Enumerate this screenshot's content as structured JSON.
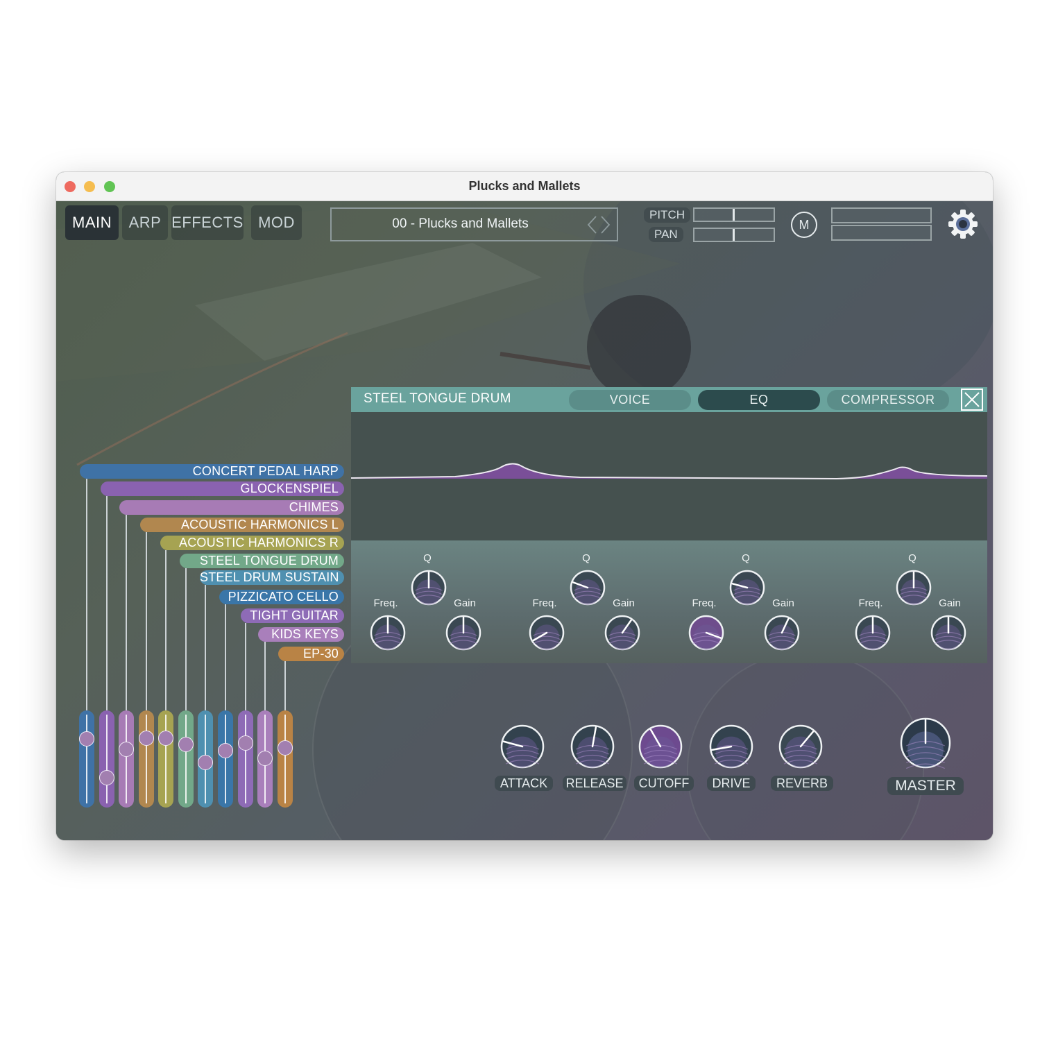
{
  "window": {
    "title": "Plucks and Mallets"
  },
  "tabs": [
    {
      "label": "MAIN",
      "active": true
    },
    {
      "label": "ARP",
      "active": false
    },
    {
      "label": "EFFECTS",
      "active": false
    },
    {
      "label": "MOD",
      "active": false
    }
  ],
  "preset": {
    "name": "00 - Plucks and Mallets"
  },
  "pitch_label": "PITCH",
  "pan_label": "PAN",
  "mono_button": "M",
  "layers": [
    {
      "name": "CONCERT PEDAL HARP",
      "color": "#3f72a6"
    },
    {
      "name": "GLOCKENSPIEL",
      "color": "#8a62b0"
    },
    {
      "name": "CHIMES",
      "color": "#a77bb5"
    },
    {
      "name": "ACOUSTIC HARMONICS L",
      "color": "#b1874f"
    },
    {
      "name": "ACOUSTIC HARMONICS R",
      "color": "#a6a352"
    },
    {
      "name": "STEEL TONGUE DRUM",
      "color": "#72a889"
    },
    {
      "name": "STEEL DRUM SUSTAIN",
      "color": "#4f90b0"
    },
    {
      "name": "PIZZICATO CELLO",
      "color": "#3a76a8"
    },
    {
      "name": "TIGHT GUITAR",
      "color": "#8e6bb6"
    },
    {
      "name": "KIDS KEYS",
      "color": "#a97fbb"
    },
    {
      "name": "EP-30",
      "color": "#b98345"
    }
  ],
  "fader_levels": [
    0.78,
    0.26,
    0.64,
    0.79,
    0.79,
    0.7,
    0.46,
    0.62,
    0.72,
    0.52,
    0.66
  ],
  "layer_panel": {
    "title": "STEEL TONGUE DRUM",
    "tabs": [
      {
        "label": "VOICE",
        "active": false
      },
      {
        "label": "EQ",
        "active": true
      },
      {
        "label": "COMPRESSOR",
        "active": false
      }
    ],
    "eq_bands": [
      {
        "q_label": "Q",
        "freq_label": "Freq.",
        "gain_label": "Gain"
      },
      {
        "q_label": "Q",
        "freq_label": "Freq.",
        "gain_label": "Gain"
      },
      {
        "q_label": "Q",
        "freq_label": "Freq.",
        "gain_label": "Gain"
      },
      {
        "q_label": "Q",
        "freq_label": "Freq.",
        "gain_label": "Gain"
      }
    ]
  },
  "macros": [
    {
      "label": "ATTACK"
    },
    {
      "label": "RELEASE"
    },
    {
      "label": "CUTOFF"
    },
    {
      "label": "DRIVE"
    },
    {
      "label": "REVERB"
    }
  ],
  "master": {
    "label": "MASTER"
  },
  "colors": {
    "panel_header": "#6aa39d",
    "active_tab": "#2c4b4d",
    "knob_fill": "#3a4852",
    "eq_curve_fill": "#7a4f98"
  }
}
